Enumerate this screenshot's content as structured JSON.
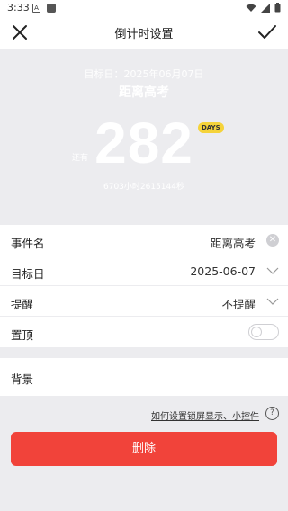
{
  "status_bar": {
    "time": "3:33"
  },
  "header": {
    "title": "倒计时设置"
  },
  "hero": {
    "target_date_text": "目标日：2025年06月07日",
    "event_name": "距离高考",
    "days_number": "282",
    "days_badge": "DAYS",
    "side_label": "还有",
    "sub_text": "6703小时2615144秒"
  },
  "form": {
    "event_name_label": "事件名",
    "event_name_value": "距离高考",
    "target_day_label": "目标日",
    "target_day_value": "2025-06-07",
    "reminder_label": "提醒",
    "reminder_value": "不提醒",
    "pin_label": "置顶",
    "pin_on": false,
    "background_label": "背景"
  },
  "help": {
    "link_text": "如何设置锁屏显示、小控件",
    "icon": "question-icon"
  },
  "actions": {
    "delete_label": "删除"
  },
  "colors": {
    "delete": "#f1433a",
    "badge": "#f5d33a",
    "hero_bg": "#ececef"
  }
}
